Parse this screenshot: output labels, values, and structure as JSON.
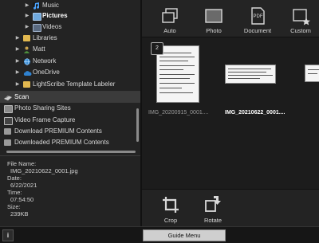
{
  "tree": {
    "items": [
      {
        "label": "Music",
        "icon": "music-note-icon",
        "color": "#4aa3ff"
      },
      {
        "label": "Pictures",
        "icon": "pictures-folder-icon",
        "color": "#6fa8dc"
      },
      {
        "label": "Videos",
        "icon": "videos-folder-icon",
        "color": "#9fb0c8"
      },
      {
        "label": "Libraries",
        "icon": "libraries-folder-icon",
        "color": "#e2b84f"
      },
      {
        "label": "Matt",
        "icon": "user-icon",
        "color": "#c9a24d"
      },
      {
        "label": "Network",
        "icon": "network-icon",
        "color": "#3d8fd6"
      },
      {
        "label": "OneDrive",
        "icon": "onedrive-cloud-icon",
        "color": "#2f82d0"
      },
      {
        "label": "LightScribe Template Labeler",
        "icon": "folder-icon",
        "color": "#e2b84f"
      }
    ],
    "tasks": [
      {
        "label": "Scan",
        "icon": "scan-icon"
      },
      {
        "label": "Photo Sharing Sites",
        "icon": "photo-sharing-icon"
      },
      {
        "label": "Video Frame Capture",
        "icon": "video-frame-icon"
      },
      {
        "label": "Download PREMIUM Contents",
        "icon": "download-folder-icon"
      },
      {
        "label": "Downloaded PREMIUM Contents",
        "icon": "downloaded-folder-icon"
      }
    ]
  },
  "info": {
    "file_name_label": "File Name:",
    "file_name": "IMG_20210622_0001.jpg",
    "date_label": "Date:",
    "date": "6/22/2021",
    "time_label": "Time:",
    "time": "07:54:50",
    "size_label": "Size:",
    "size": "239KB"
  },
  "toolbar": {
    "auto": "Auto",
    "photo": "Photo",
    "document": "Document",
    "custom": "Custom",
    "pdf_badge": "PDF"
  },
  "thumbs": [
    {
      "caption": "IMG_20200915_0001....",
      "badge": "2"
    },
    {
      "caption": "IMG_20210622_0001...."
    },
    {
      "caption": ""
    }
  ],
  "bottom": {
    "crop": "Crop",
    "rotate": "Rotate"
  },
  "status": {
    "info_symbol": "i",
    "guide_menu": "Guide Menu"
  }
}
